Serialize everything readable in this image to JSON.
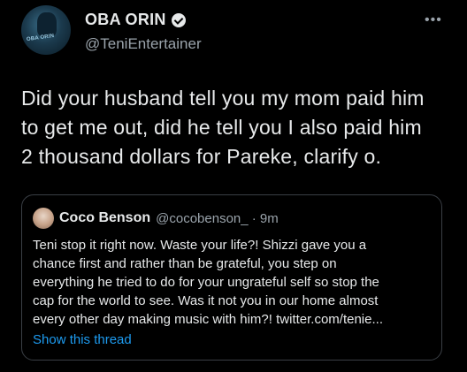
{
  "author": {
    "display_name": "OBA ORIN",
    "handle": "@TeniEntertainer",
    "avatar_text": "OBA ORIN"
  },
  "more_glyph": "•••",
  "tweet": {
    "lines": [
      "Did your husband tell you my mom paid him",
      "to get me out, did he tell you I also paid him",
      "2 thousand dollars for Pareke, clarify o."
    ]
  },
  "quote": {
    "display_name": "Coco Benson",
    "handle_time": "@cocobenson_ · 9m",
    "lines": [
      "Teni stop it right now. Waste your life?! Shizzi gave you a",
      "chance first and rather than be grateful, you step on",
      "everything he tried to do for your ungrateful self so stop the",
      "cap for the world to see. Was it not you in our home almost",
      "every other day making music with him?! twitter.com/tenie..."
    ],
    "show_thread": "Show this thread"
  },
  "colors": {
    "background": "#000000",
    "text": "#e7e9ea",
    "secondary": "#9aa3ab",
    "link": "#1d9bf0",
    "border": "#3a3f45"
  }
}
